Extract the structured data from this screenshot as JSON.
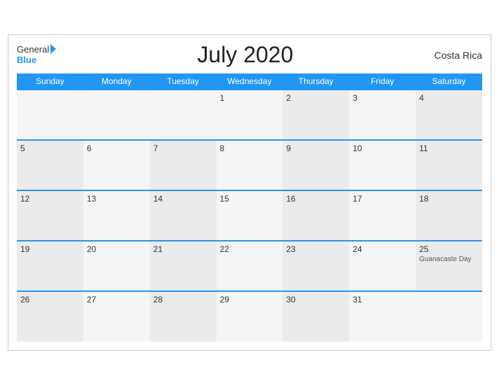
{
  "header": {
    "logo_general": "General",
    "logo_blue": "Blue",
    "title": "July 2020",
    "country": "Costa Rica"
  },
  "weekdays": [
    "Sunday",
    "Monday",
    "Tuesday",
    "Wednesday",
    "Thursday",
    "Friday",
    "Saturday"
  ],
  "weeks": [
    [
      {
        "day": "",
        "empty": true
      },
      {
        "day": "",
        "empty": true
      },
      {
        "day": "",
        "empty": true
      },
      {
        "day": "1",
        "holiday": ""
      },
      {
        "day": "2",
        "holiday": ""
      },
      {
        "day": "3",
        "holiday": ""
      },
      {
        "day": "4",
        "holiday": ""
      }
    ],
    [
      {
        "day": "5",
        "holiday": ""
      },
      {
        "day": "6",
        "holiday": ""
      },
      {
        "day": "7",
        "holiday": ""
      },
      {
        "day": "8",
        "holiday": ""
      },
      {
        "day": "9",
        "holiday": ""
      },
      {
        "day": "10",
        "holiday": ""
      },
      {
        "day": "11",
        "holiday": ""
      }
    ],
    [
      {
        "day": "12",
        "holiday": ""
      },
      {
        "day": "13",
        "holiday": ""
      },
      {
        "day": "14",
        "holiday": ""
      },
      {
        "day": "15",
        "holiday": ""
      },
      {
        "day": "16",
        "holiday": ""
      },
      {
        "day": "17",
        "holiday": ""
      },
      {
        "day": "18",
        "holiday": ""
      }
    ],
    [
      {
        "day": "19",
        "holiday": ""
      },
      {
        "day": "20",
        "holiday": ""
      },
      {
        "day": "21",
        "holiday": ""
      },
      {
        "day": "22",
        "holiday": ""
      },
      {
        "day": "23",
        "holiday": ""
      },
      {
        "day": "24",
        "holiday": ""
      },
      {
        "day": "25",
        "holiday": "Guanacaste Day"
      }
    ],
    [
      {
        "day": "26",
        "holiday": ""
      },
      {
        "day": "27",
        "holiday": ""
      },
      {
        "day": "28",
        "holiday": ""
      },
      {
        "day": "29",
        "holiday": ""
      },
      {
        "day": "30",
        "holiday": ""
      },
      {
        "day": "31",
        "holiday": ""
      },
      {
        "day": "",
        "empty": true
      }
    ]
  ]
}
